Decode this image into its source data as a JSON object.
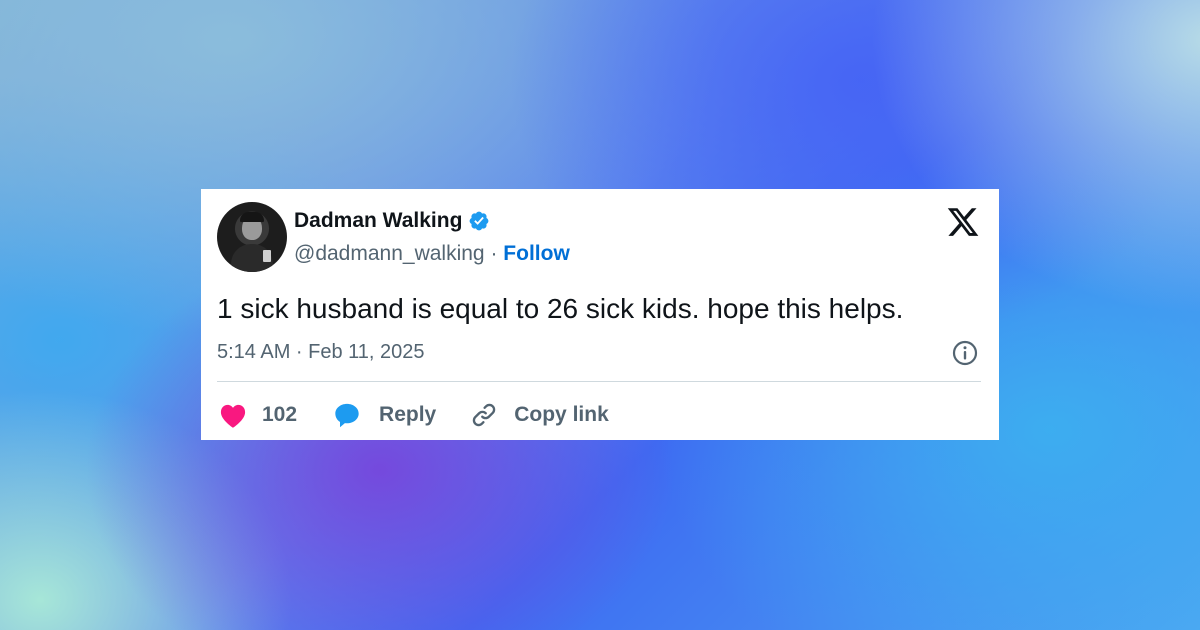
{
  "author": {
    "display_name": "Dadman Walking",
    "handle": "@dadmann_walking",
    "separator": "·",
    "follow_label": "Follow",
    "verified": true
  },
  "tweet": {
    "text": "1 sick husband is equal to 26 sick kids. hope this helps.",
    "timestamp": "5:14 AM · Feb 11, 2025"
  },
  "actions": {
    "likes_count": "102",
    "reply_label": "Reply",
    "copy_link_label": "Copy link"
  },
  "icons": {
    "platform_logo": "x-logo-icon",
    "verified": "verified-badge-icon",
    "info": "info-icon",
    "like": "heart-icon",
    "reply": "speech-bubble-icon",
    "copy": "link-icon"
  },
  "colors": {
    "like": "#f91880",
    "reply": "#1d9bf0",
    "follow": "#006fd6",
    "verified": "#1d9bf0",
    "text_primary": "#0f1419",
    "text_secondary": "#536471"
  }
}
